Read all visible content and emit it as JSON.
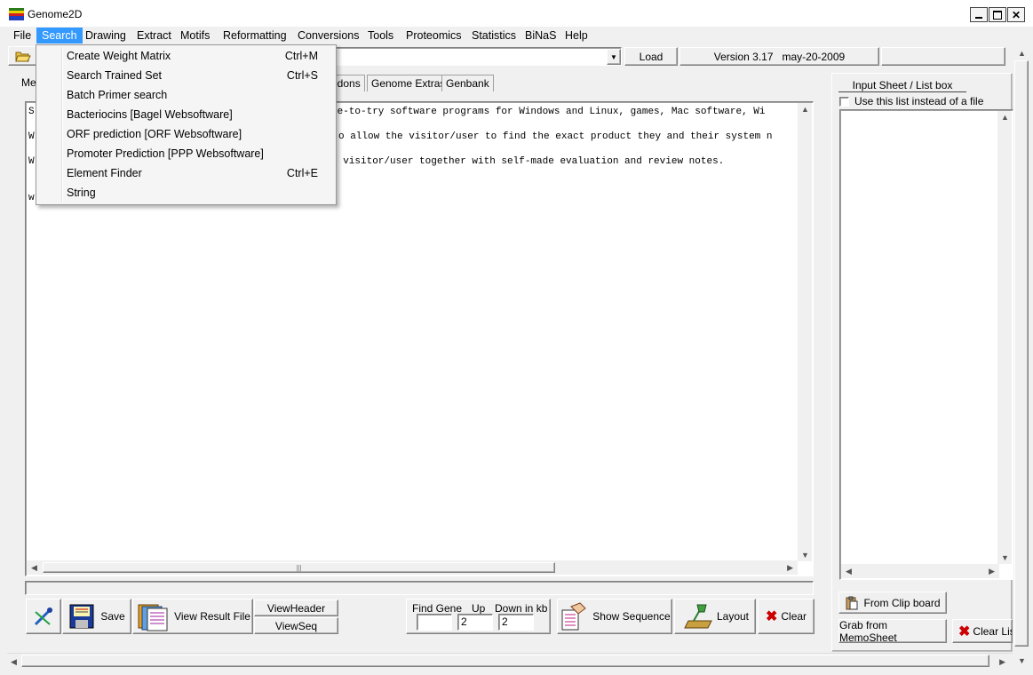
{
  "window": {
    "title": "Genome2D"
  },
  "menu": [
    {
      "label": "File",
      "active": false
    },
    {
      "label": "Search",
      "active": true
    },
    {
      "label": "Drawing",
      "active": false
    },
    {
      "label": "Extract",
      "active": false
    },
    {
      "label": "Motifs",
      "active": false
    },
    {
      "label": "Reformatting",
      "active": false
    },
    {
      "label": "Conversions",
      "active": false
    },
    {
      "label": "Tools",
      "active": false
    },
    {
      "label": "Proteomics",
      "active": false
    },
    {
      "label": "Statistics",
      "active": false
    },
    {
      "label": "BiNaS",
      "active": false
    },
    {
      "label": "Help",
      "active": false
    }
  ],
  "search_menu": [
    {
      "label": "Create Weight Matrix",
      "shortcut": "Ctrl+M"
    },
    {
      "label": "Search Trained Set",
      "shortcut": "Ctrl+S"
    },
    {
      "label": "Batch Primer search",
      "shortcut": ""
    },
    {
      "label": "Bacteriocins [Bagel Websoftware]",
      "shortcut": ""
    },
    {
      "label": "ORF prediction [ORF Websoftware]",
      "shortcut": ""
    },
    {
      "label": "Promoter Prediction [PPP Websoftware]",
      "shortcut": ""
    },
    {
      "label": "Element Finder",
      "shortcut": "Ctrl+E"
    },
    {
      "label": "String",
      "shortcut": ""
    }
  ],
  "toolbar": {
    "load_label": "Load",
    "version": "Version 3.17   may-20-2009"
  },
  "tabs": [
    "Me",
    "odons",
    "Genome Extras",
    "Genbank"
  ],
  "memo": {
    "lines": [
      {
        "start": "S",
        "rest": "ee-to-try software programs for Windows and Linux, games, Mac software, Wi"
      },
      {
        "start": "W",
        "rest": "o allow the visitor/user to find the exact product they and their system n"
      },
      {
        "start": "W",
        "rest": "e visitor/user together with self-made evaluation and review notes."
      },
      {
        "start": "w",
        "rest": ""
      }
    ]
  },
  "right_panel": {
    "title": "Input Sheet / List box",
    "checkbox_label": "Use this list instead of a file",
    "from_clipboard": "From Clip board",
    "grab_memosheet": "Grab from MemoSheet",
    "clear_list": "Clear List"
  },
  "bottom": {
    "save": "Save",
    "view_result_file": "View Result File",
    "view_header": "ViewHeader",
    "view_seq": "ViewSeq",
    "find_gene": "Find Gene",
    "up": "Up",
    "down_in_kb": "Down in kb",
    "up_value": "2",
    "down_value": "2",
    "show_sequence": "Show Sequence",
    "layout": "Layout",
    "clear": "Clear"
  },
  "colors": {
    "menu_highlight": "#3399ff",
    "clear_x": "#cc0000"
  }
}
